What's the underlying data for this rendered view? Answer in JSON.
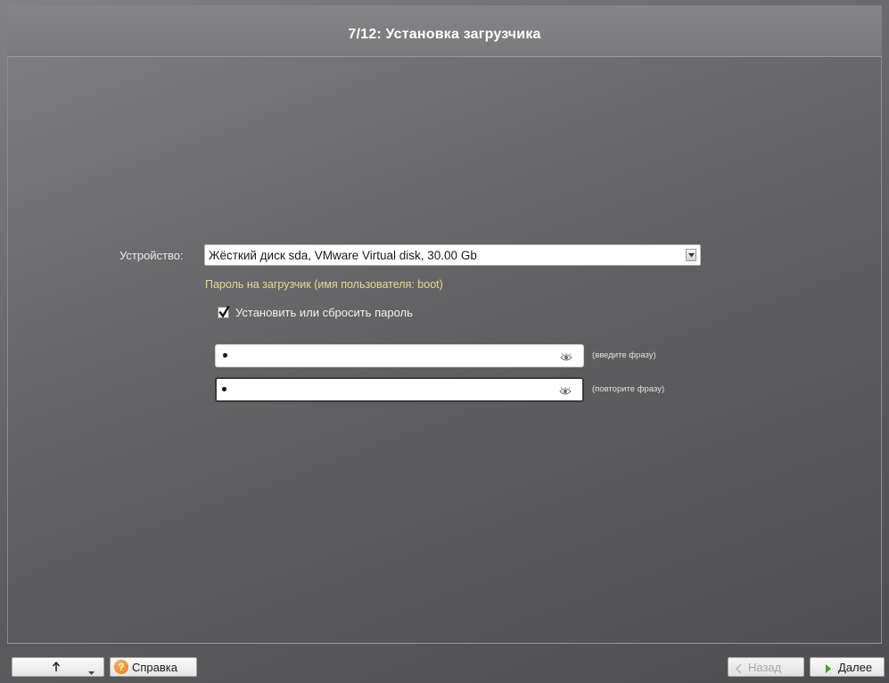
{
  "window": {
    "title": "7/12: Установка загрузчика"
  },
  "device": {
    "label": "Устройство:",
    "selected": "Жёсткий диск sda, VMware Virtual disk, 30.00 Gb",
    "icon": "chevron-down-icon"
  },
  "bootloader_password": {
    "hint": "Пароль на загрузчик (имя пользователя: boot)",
    "checkbox_label": "Установить или сбросить пароль",
    "checkbox_checked": true,
    "field1_caption": "(введите фразу)",
    "field2_caption": "(повторите фразу)",
    "field1_value": "•",
    "field2_value": "•"
  },
  "footer": {
    "help_label": "Справка",
    "back_label": "Назад",
    "next_label": "Далее",
    "back_enabled": false
  },
  "colors": {
    "background": "#5e5e60",
    "hint": "#e8d98a",
    "help_icon": "#e8780e",
    "next_chevron": "#3fa516"
  }
}
